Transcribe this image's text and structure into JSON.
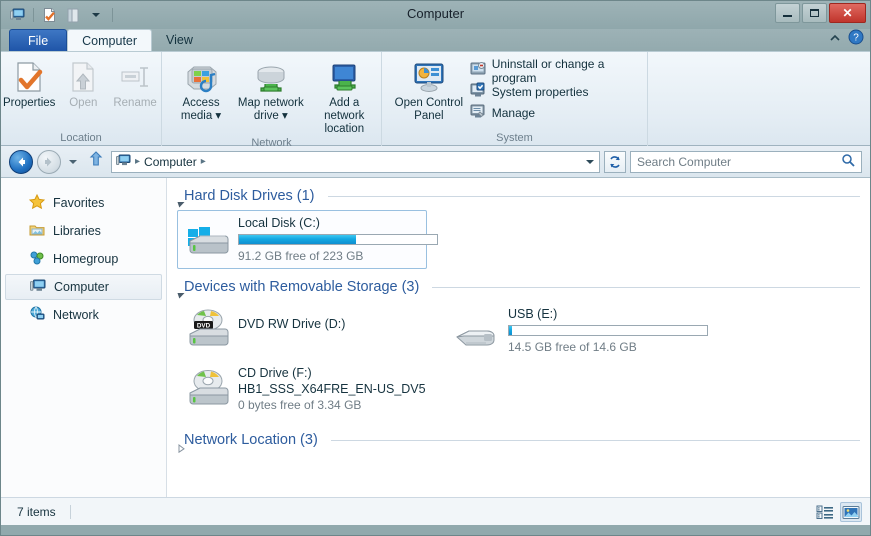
{
  "window": {
    "title": "Computer",
    "controls": {
      "minimize": "minimize",
      "maximize": "maximize",
      "close": "✕"
    }
  },
  "quick_access": {
    "items": [
      "computer-icon",
      "properties-icon",
      "open-icon",
      "customize-dropdown"
    ]
  },
  "tabs": [
    {
      "id": "file",
      "label": "File"
    },
    {
      "id": "computer",
      "label": "Computer"
    },
    {
      "id": "view",
      "label": "View"
    }
  ],
  "ribbon": {
    "collapse_label": "⌃",
    "help_label": "?",
    "groups": [
      {
        "name": "Location",
        "label": "Location",
        "buttons": [
          {
            "label": "Properties",
            "enabled": true
          },
          {
            "label": "Open",
            "enabled": false
          },
          {
            "label": "Rename",
            "enabled": false
          }
        ]
      },
      {
        "name": "Network",
        "label": "Network",
        "buttons": [
          {
            "label": "Access media ▾",
            "enabled": true
          },
          {
            "label": "Map network drive ▾",
            "enabled": true
          },
          {
            "label": "Add a network location",
            "enabled": true
          }
        ]
      },
      {
        "name": "System",
        "label": "System",
        "big_button": {
          "label": "Open Control Panel",
          "enabled": true
        },
        "small_buttons": [
          {
            "label": "Uninstall or change a program"
          },
          {
            "label": "System properties"
          },
          {
            "label": "Manage"
          }
        ]
      }
    ]
  },
  "address_bar": {
    "back_tooltip": "Back",
    "forward_tooltip": "Forward",
    "recent_tooltip": "Recent locations",
    "up_tooltip": "Up one level",
    "breadcrumb": [
      "Computer"
    ],
    "breadcrumb_separator": "▸",
    "refresh_tooltip": "Refresh",
    "dropdown_tooltip": "Previous locations"
  },
  "search": {
    "placeholder": "Search Computer",
    "value": ""
  },
  "sidebar": {
    "items": [
      {
        "label": "Favorites",
        "icon": "star-icon",
        "selected": false
      },
      {
        "label": "Libraries",
        "icon": "library-folder-icon",
        "selected": false
      },
      {
        "label": "Homegroup",
        "icon": "homegroup-icon",
        "selected": false
      },
      {
        "label": "Computer",
        "icon": "computer-icon",
        "selected": true
      },
      {
        "label": "Network",
        "icon": "network-globe-icon",
        "selected": false
      }
    ]
  },
  "content": {
    "groups": [
      {
        "title": "Hard Disk Drives (1)",
        "expanded": true,
        "drives": [
          {
            "name": "Local Disk (C:)",
            "volume_label": "",
            "capacity_text": "91.2 GB free of 223 GB",
            "free_gb": 91.2,
            "total_gb": 223,
            "used_percent": 59,
            "icon": "windows-hard-drive-icon",
            "selected": true,
            "has_bar": true
          }
        ]
      },
      {
        "title": "Devices with Removable Storage (3)",
        "expanded": true,
        "drives": [
          {
            "name": "DVD RW Drive (D:)",
            "volume_label": "",
            "capacity_text": "",
            "icon": "dvd-rw-drive-icon",
            "selected": false,
            "has_bar": false
          },
          {
            "name": "USB (E:)",
            "volume_label": "",
            "capacity_text": "14.5 GB free of 14.6 GB",
            "free_gb": 14.5,
            "total_gb": 14.6,
            "used_percent": 1,
            "icon": "usb-flash-drive-icon",
            "selected": false,
            "has_bar": true
          },
          {
            "name": "CD Drive (F:)",
            "volume_label": "HB1_SSS_X64FRE_EN-US_DV5",
            "capacity_text": "0 bytes free of 3.34 GB",
            "free_gb": 0,
            "total_gb": 3.34,
            "used_percent": 100,
            "icon": "cd-drive-icon",
            "selected": false,
            "has_bar": false
          }
        ]
      },
      {
        "title": "Network Location (3)",
        "expanded": false,
        "drives": []
      }
    ]
  },
  "status": {
    "item_count": "7 items",
    "view_details_label": "details-view",
    "view_large_icons_label": "large-icons-view"
  },
  "colors": {
    "accent_blue": "#1f55a8",
    "group_title": "#2d5c9e",
    "bar_fill": "#13a8e2",
    "close_red": "#c0352c",
    "titlebar": "#97adb1"
  }
}
